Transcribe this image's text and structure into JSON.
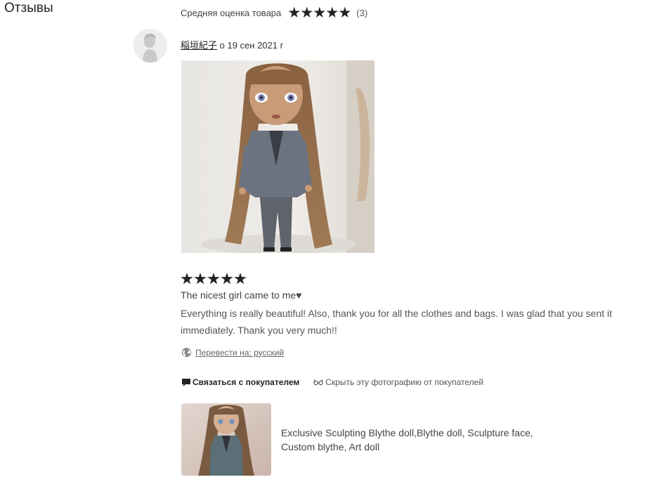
{
  "section": {
    "title": "Отзывы"
  },
  "average": {
    "label": "Средняя оценка товара",
    "rating": 5,
    "max_rating": 5,
    "count_text": "(3)"
  },
  "review": {
    "reviewer_name": "稲垣紀子",
    "date_text": "о 19 сен 2021 г",
    "rating": 5,
    "title": "The nicest girl came to me♥",
    "body": "Everything is really beautiful! Also, thank you for all the clothes and bags. I was glad that you sent it immediately. Thank you very much!!",
    "translate_label": "Перевести на: русский",
    "contact_label": "Связаться с покупателем",
    "hide_photo_label": "Скрыть эту фотографию от покупателей"
  },
  "product": {
    "title": "Exclusive Sculpting Blythe doll,Blythe doll, Sculpture face, Custom blythe, Art doll"
  },
  "colors": {
    "text": "#222222",
    "muted": "#555555",
    "star": "#222222"
  },
  "icons": {
    "avatar": "person-silhouette-icon",
    "globe": "globe-icon",
    "contact": "message-icon",
    "hide": "glasses-icon"
  }
}
